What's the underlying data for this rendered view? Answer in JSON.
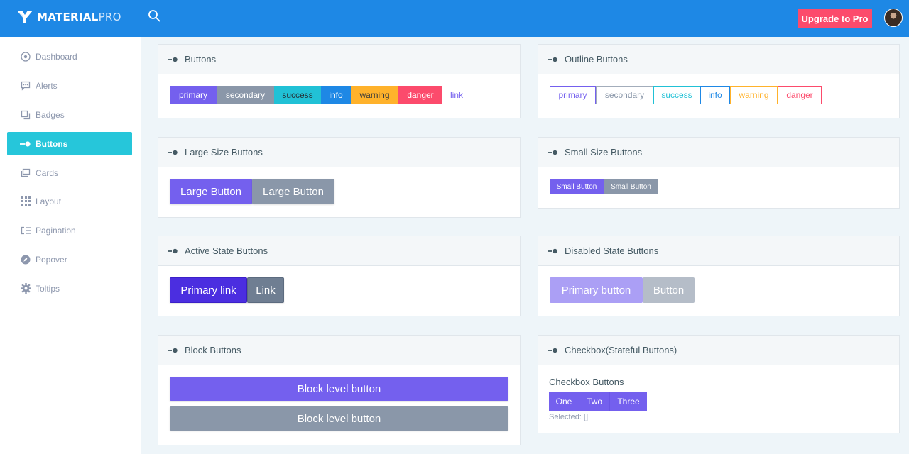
{
  "brand": {
    "bold": "MATERIAL",
    "light": "PRO"
  },
  "topbar": {
    "upgrade_label": "Upgrade to Pro"
  },
  "sidebar": {
    "items": [
      {
        "label": "Dashboard",
        "icon": "dashboard-icon"
      },
      {
        "label": "Alerts",
        "icon": "message-icon"
      },
      {
        "label": "Badges",
        "icon": "copy-icon"
      },
      {
        "label": "Buttons",
        "icon": "toggle-icon",
        "active": true
      },
      {
        "label": "Cards",
        "icon": "cards-icon"
      },
      {
        "label": "Layout",
        "icon": "grid-icon"
      },
      {
        "label": "Pagination",
        "icon": "list-icon"
      },
      {
        "label": "Popover",
        "icon": "compass-icon"
      },
      {
        "label": "Toltips",
        "icon": "gear-icon"
      }
    ]
  },
  "cards": {
    "buttons": {
      "title": "Buttons",
      "items": [
        "primary",
        "secondary",
        "success",
        "info",
        "warning",
        "danger",
        "link"
      ]
    },
    "outline": {
      "title": "Outline Buttons",
      "items": [
        "primary",
        "secondary",
        "success",
        "info",
        "warning",
        "danger"
      ]
    },
    "large": {
      "title": "Large Size Buttons",
      "items": [
        "Large Button",
        "Large Button"
      ]
    },
    "small": {
      "title": "Small Size Buttons",
      "items": [
        "Small Button",
        "Small Button"
      ]
    },
    "active": {
      "title": "Active State Buttons",
      "items": [
        "Primary link",
        "Link"
      ]
    },
    "disabled": {
      "title": "Disabled State Buttons",
      "items": [
        "Primary button",
        "Button"
      ]
    },
    "block": {
      "title": "Block Buttons",
      "items": [
        "Block level button",
        "Block level button"
      ]
    },
    "checkbox": {
      "title": "Checkbox(Stateful Buttons)",
      "label": "Checkbox Buttons",
      "items": [
        "One",
        "Two",
        "Three"
      ],
      "selected": "Selected: []"
    }
  },
  "colors": {
    "topbar": "#1e88e5",
    "primary": "#7460ee",
    "secondary": "#8a97a9",
    "success": "#21c1d6",
    "info": "#1e88e5",
    "warning": "#ffb22b",
    "danger": "#fc4b6c",
    "sidebar_active": "#26c6da"
  }
}
